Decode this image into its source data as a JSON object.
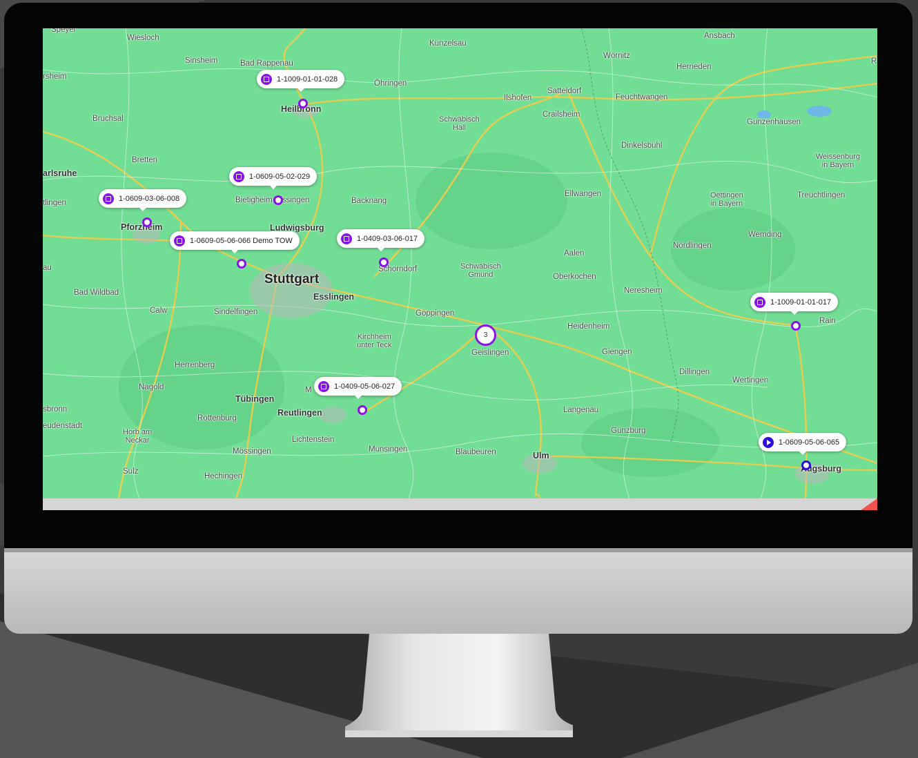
{
  "colors": {
    "accent": "#8a12e6",
    "accent_blue": "#2b0fdc",
    "map_land": "#72dd95",
    "road": "#f2cd4a"
  },
  "map": {
    "places": [
      {
        "name": "Speyer",
        "cls": ""
      },
      {
        "name": "Wiesloch",
        "cls": ""
      },
      {
        "name": "Sinsheim",
        "cls": ""
      },
      {
        "name": "Bad Rappenau",
        "cls": ""
      },
      {
        "name": "Künzelsau",
        "cls": ""
      },
      {
        "name": "Ansbach",
        "cls": ""
      },
      {
        "name": "Wörnitz",
        "cls": ""
      },
      {
        "name": "Herrieden",
        "cls": ""
      },
      {
        "name": "rsheim",
        "cls": ""
      },
      {
        "name": "Öhringen",
        "cls": ""
      },
      {
        "name": "Heilbronn",
        "cls": "mid"
      },
      {
        "name": "Ilshofen",
        "cls": ""
      },
      {
        "name": "Satteldorf",
        "cls": ""
      },
      {
        "name": "Feuchtwangen",
        "cls": ""
      },
      {
        "name": "Crailsheim",
        "cls": ""
      },
      {
        "name": "Bruchsal",
        "cls": ""
      },
      {
        "name": "Schwäbisch\nHall",
        "cls": "small"
      },
      {
        "name": "Gunzenhausen",
        "cls": ""
      },
      {
        "name": "Dinkelsbühl",
        "cls": ""
      },
      {
        "name": "Bretten",
        "cls": ""
      },
      {
        "name": "Weissenburg\nin Bayern",
        "cls": "small"
      },
      {
        "name": "arlsruhe",
        "cls": "mid"
      },
      {
        "name": "Bietigheim-Bissingen",
        "cls": ""
      },
      {
        "name": "Backnang",
        "cls": ""
      },
      {
        "name": "Ellwangen",
        "cls": ""
      },
      {
        "name": "Oettingen\nin Bayern",
        "cls": "small"
      },
      {
        "name": "Treuchtlingen",
        "cls": ""
      },
      {
        "name": "tlingen",
        "cls": ""
      },
      {
        "name": "Pforzheim",
        "cls": "mid"
      },
      {
        "name": "Ludwigsburg",
        "cls": "mid"
      },
      {
        "name": "Wemding",
        "cls": ""
      },
      {
        "name": "Nördlingen",
        "cls": ""
      },
      {
        "name": "Aalen",
        "cls": ""
      },
      {
        "name": "Schorndorf",
        "cls": ""
      },
      {
        "name": "Schwäbisch\nGmünd",
        "cls": "small"
      },
      {
        "name": "Oberkochen",
        "cls": ""
      },
      {
        "name": "Stuttgart",
        "cls": "big"
      },
      {
        "name": "Bad Wildbad",
        "cls": ""
      },
      {
        "name": "Esslingen",
        "cls": "mid"
      },
      {
        "name": "Neresheim",
        "cls": ""
      },
      {
        "name": "Calw",
        "cls": ""
      },
      {
        "name": "Sindelfingen",
        "cls": ""
      },
      {
        "name": "Göppingen",
        "cls": ""
      },
      {
        "name": "Rain",
        "cls": ""
      },
      {
        "name": "Heidenheim",
        "cls": ""
      },
      {
        "name": "Kirchheim\nunter Teck",
        "cls": "small"
      },
      {
        "name": "Geislingen",
        "cls": ""
      },
      {
        "name": "Giengen",
        "cls": ""
      },
      {
        "name": "Herrenberg",
        "cls": ""
      },
      {
        "name": "Dillingen",
        "cls": ""
      },
      {
        "name": "Wertingen",
        "cls": ""
      },
      {
        "name": "Nagold",
        "cls": ""
      },
      {
        "name": "M",
        "cls": ""
      },
      {
        "name": "Tübingen",
        "cls": "mid"
      },
      {
        "name": "Reutlingen",
        "cls": "mid"
      },
      {
        "name": "sbronn",
        "cls": ""
      },
      {
        "name": "Rottenburg",
        "cls": ""
      },
      {
        "name": "Langenau",
        "cls": ""
      },
      {
        "name": "eudenstadt",
        "cls": ""
      },
      {
        "name": "Horb am\nNeckar",
        "cls": "small"
      },
      {
        "name": "Lichtenstein",
        "cls": ""
      },
      {
        "name": "Günzburg",
        "cls": ""
      },
      {
        "name": "Mössingen",
        "cls": ""
      },
      {
        "name": "Münsingen",
        "cls": ""
      },
      {
        "name": "Blaubeuren",
        "cls": ""
      },
      {
        "name": "Ulm",
        "cls": "mid"
      },
      {
        "name": "Augsburg",
        "cls": "mid"
      },
      {
        "name": "Sulz",
        "cls": ""
      },
      {
        "name": "Hechingen",
        "cls": ""
      },
      {
        "name": "au",
        "cls": ""
      },
      {
        "name": "R",
        "cls": ""
      }
    ],
    "markers": [
      {
        "label": "1-1009-01-01-028",
        "icon": "stop-icon",
        "status": "stopped"
      },
      {
        "label": "1-0609-05-02-029",
        "icon": "stop-icon",
        "status": "stopped"
      },
      {
        "label": "1-0609-03-06-008",
        "icon": "stop-icon",
        "status": "stopped"
      },
      {
        "label": "1-0609-05-06-066 Demo TOW",
        "icon": "stop-icon",
        "status": "stopped"
      },
      {
        "label": "1-0409-03-06-017",
        "icon": "stop-icon",
        "status": "stopped"
      },
      {
        "label": "1-1009-01-01-017",
        "icon": "stop-icon",
        "status": "stopped"
      },
      {
        "label": "1-0409-05-06-027",
        "icon": "stop-icon",
        "status": "stopped"
      },
      {
        "label": "1-0609-05-06-065",
        "icon": "play-icon",
        "status": "moving"
      }
    ],
    "cluster": {
      "count": "3"
    }
  }
}
